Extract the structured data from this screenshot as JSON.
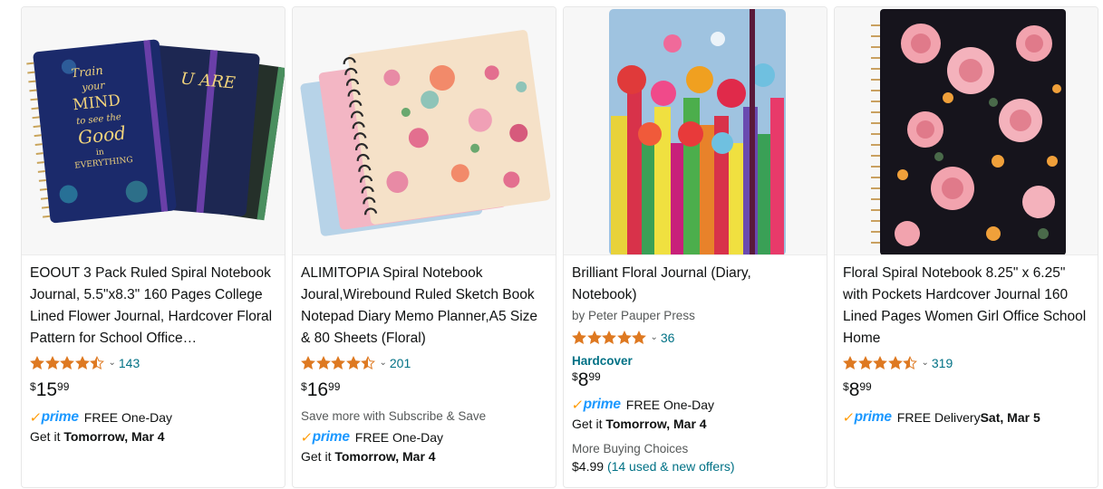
{
  "products": [
    {
      "title": "EOOUT 3 Pack Ruled Spiral Notebook Journal, 5.5\"x8.3\" 160 Pages College Lined Flower Journal, Hardcover Floral Pattern for School Office…",
      "rating": 4.5,
      "reviews": "143",
      "price_symbol": "$",
      "price_whole": "15",
      "price_fraction": "99",
      "prime_text": "FREE One-Day",
      "delivery_prefix": "Get it ",
      "delivery_date": "Tomorrow, Mar 4",
      "cover_text": [
        "Train",
        "your",
        "MIND",
        "to see the",
        "Good",
        "in",
        "EVERYTHING"
      ]
    },
    {
      "title": "ALIMITOPIA Spiral Notebook Joural,Wirebound Ruled Sketch Book Notepad Diary Memo Planner,A5 Size & 80 Sheets (Floral)",
      "rating": 4.5,
      "reviews": "201",
      "price_symbol": "$",
      "price_whole": "16",
      "price_fraction": "99",
      "subscribe": "Save more with Subscribe & Save",
      "prime_text": "FREE One-Day",
      "delivery_prefix": "Get it ",
      "delivery_date": "Tomorrow, Mar 4"
    },
    {
      "title": "Brilliant Floral Journal (Diary, Notebook)",
      "author": "by Peter Pauper Press",
      "rating": 5,
      "reviews": "36",
      "binding": "Hardcover",
      "price_symbol": "$",
      "price_whole": "8",
      "price_fraction": "99",
      "prime_text": "FREE One-Day",
      "delivery_prefix": "Get it ",
      "delivery_date": "Tomorrow, Mar 4",
      "more_buying": "More Buying Choices",
      "offer_price": "$4.99",
      "offer_link": "(14 used & new offers)"
    },
    {
      "title": "Floral Spiral Notebook 8.25\" x 6.25\" with Pockets Hardcover Journal 160 Lined Pages Women Girl Office School Home",
      "rating": 4.5,
      "reviews": "319",
      "price_symbol": "$",
      "price_whole": "8",
      "price_fraction": "99",
      "prime_text": "FREE Delivery ",
      "prime_date": "Sat, Mar 5"
    }
  ],
  "prime_word": "prime",
  "prime_check": "✓",
  "chevron": "⌄",
  "icons": {
    "star": "star-icon",
    "half_star": "half-star-icon",
    "chevron": "chevron-down-icon",
    "prime": "prime-logo-icon"
  },
  "colors": {
    "star": "#de7921",
    "link": "#007185",
    "prime_blue": "#1a98ff",
    "prime_orange": "#ff9900",
    "muted": "#565959"
  }
}
